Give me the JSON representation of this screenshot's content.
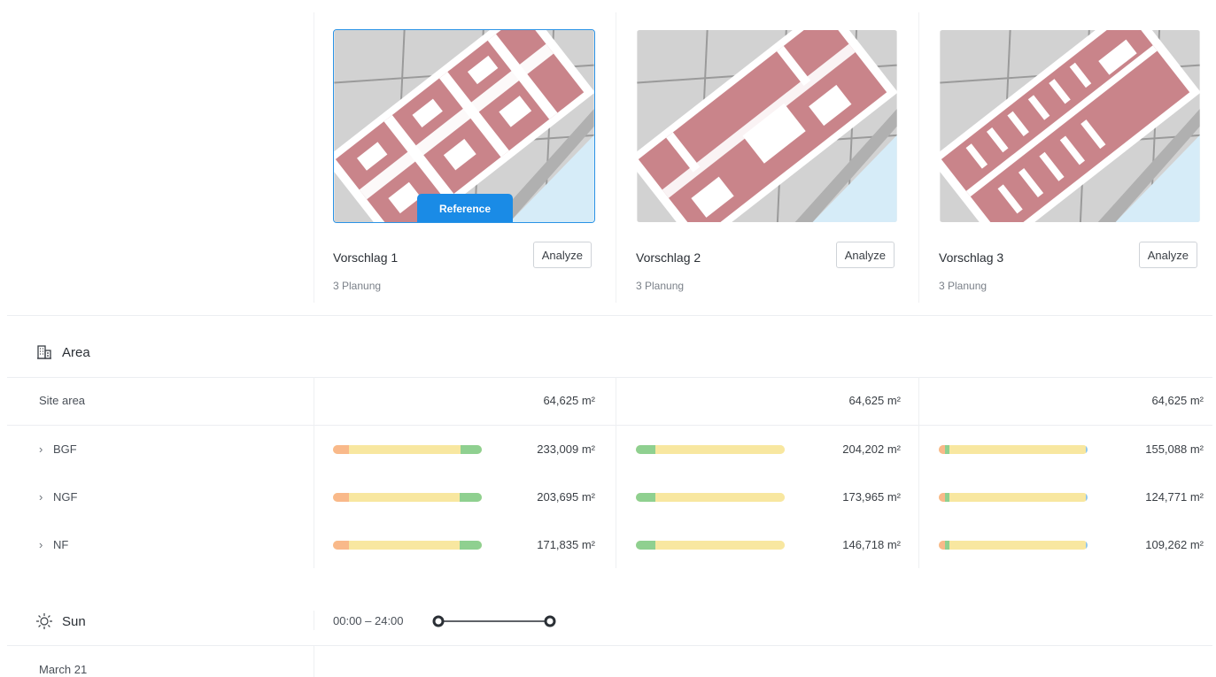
{
  "proposals": [
    {
      "title": "Vorschlag 1",
      "subtitle": "3 Planung",
      "analyze_label": "Analyze",
      "badge": "Reference"
    },
    {
      "title": "Vorschlag 2",
      "subtitle": "3 Planung",
      "analyze_label": "Analyze"
    },
    {
      "title": "Vorschlag 3",
      "subtitle": "3 Planung",
      "analyze_label": "Analyze"
    }
  ],
  "area": {
    "title": "Area",
    "icon": "building-icon",
    "rows": [
      {
        "label": "Site area",
        "expandable": false,
        "values": [
          "64,625 m²",
          "64,625 m²",
          "64,625 m²"
        ]
      },
      {
        "label": "BGF",
        "expandable": true,
        "values": [
          "233,009 m²",
          "204,202 m²",
          "155,088 m²"
        ],
        "bars": [
          [
            0.11,
            0.75,
            0.14,
            0
          ],
          [
            0,
            0.13,
            0.87,
            0
          ],
          [
            0.04,
            0.03,
            0.92,
            0.01
          ]
        ]
      },
      {
        "label": "NGF",
        "expandable": true,
        "values": [
          "203,695 m²",
          "173,965 m²",
          "124,771 m²"
        ],
        "bars": [
          [
            0.11,
            0.74,
            0.15,
            0
          ],
          [
            0,
            0.13,
            0.87,
            0
          ],
          [
            0.04,
            0.03,
            0.92,
            0.01
          ]
        ]
      },
      {
        "label": "NF",
        "expandable": true,
        "values": [
          "171,835 m²",
          "146,718 m²",
          "109,262 m²"
        ],
        "bars": [
          [
            0.11,
            0.74,
            0.15,
            0
          ],
          [
            0,
            0.13,
            0.87,
            0
          ],
          [
            0.04,
            0.03,
            0.92,
            0.01
          ]
        ]
      }
    ],
    "chevron": "›"
  },
  "sun": {
    "title": "Sun",
    "icon": "sun-icon",
    "time_range": "00:00 – 24:00",
    "slider": {
      "min_value": 0,
      "max_value": 24,
      "low": 0,
      "high": 24
    },
    "date_label": "March 21"
  },
  "colors": {
    "accent": "#1a8be6",
    "bar_orange": "#f9b98a",
    "bar_yellow": "#f8e7a0",
    "bar_green": "#8fd090",
    "bar_blue": "#8fc7f0",
    "building": "#c9848a"
  }
}
